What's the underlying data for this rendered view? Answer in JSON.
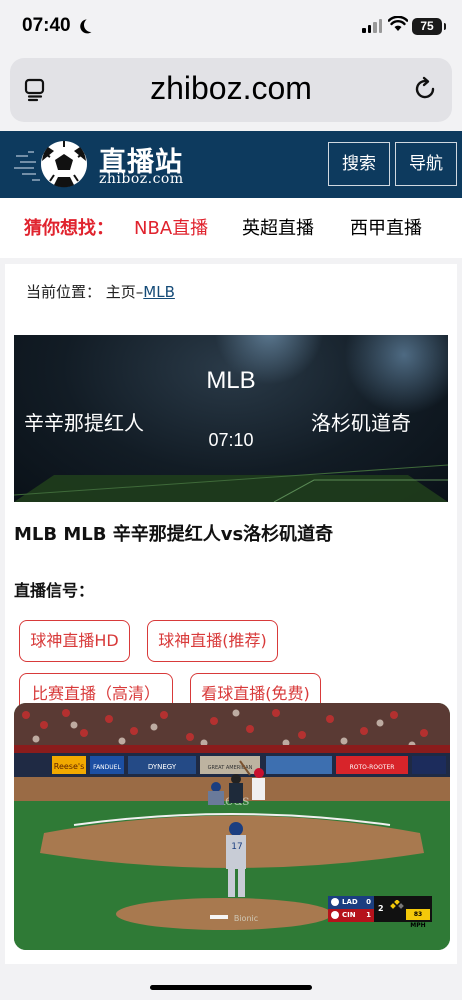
{
  "status_bar": {
    "time": "07:40",
    "battery": "75"
  },
  "browser": {
    "url": "zhiboz.com"
  },
  "site": {
    "logo_title": "直播站",
    "logo_sub": "zhiboz.com",
    "search_label": "搜索",
    "nav_label": "导航"
  },
  "guess": {
    "label": "猜你想找：",
    "items": [
      "NBA直播",
      "英超直播",
      "西甲直播"
    ],
    "active_color": "#e0232e"
  },
  "breadcrumb": {
    "prefix": "当前位置： 主页–",
    "link": "MLB"
  },
  "banner": {
    "league": "MLB",
    "home_team": "辛辛那提红人",
    "away_team": "洛杉矶道奇",
    "time": "07:10"
  },
  "match_title": "MLB MLB 辛辛那提红人vs洛杉矶道奇",
  "signals": {
    "title": "直播信号：",
    "buttons": [
      "球神直播HD",
      "球神直播(推荐)",
      "比赛直播（高清）",
      "看球直播(免费)"
    ]
  },
  "video": {
    "scorebug": {
      "away": "LAD",
      "away_score": "0",
      "home": "CIN",
      "home_score": "1",
      "inning": "2",
      "pitch": "83 MPH"
    },
    "ads": [
      "Reese's",
      "FANDUEL",
      "DYNEGY",
      "GREAT AMERICAN",
      "ROTO-ROOTER"
    ]
  },
  "icons": [
    "moon-icon",
    "cellular-signal-icon",
    "wifi-icon",
    "battery-icon",
    "reader-mode-icon",
    "reload-icon",
    "soccer-ball-logo-icon"
  ]
}
